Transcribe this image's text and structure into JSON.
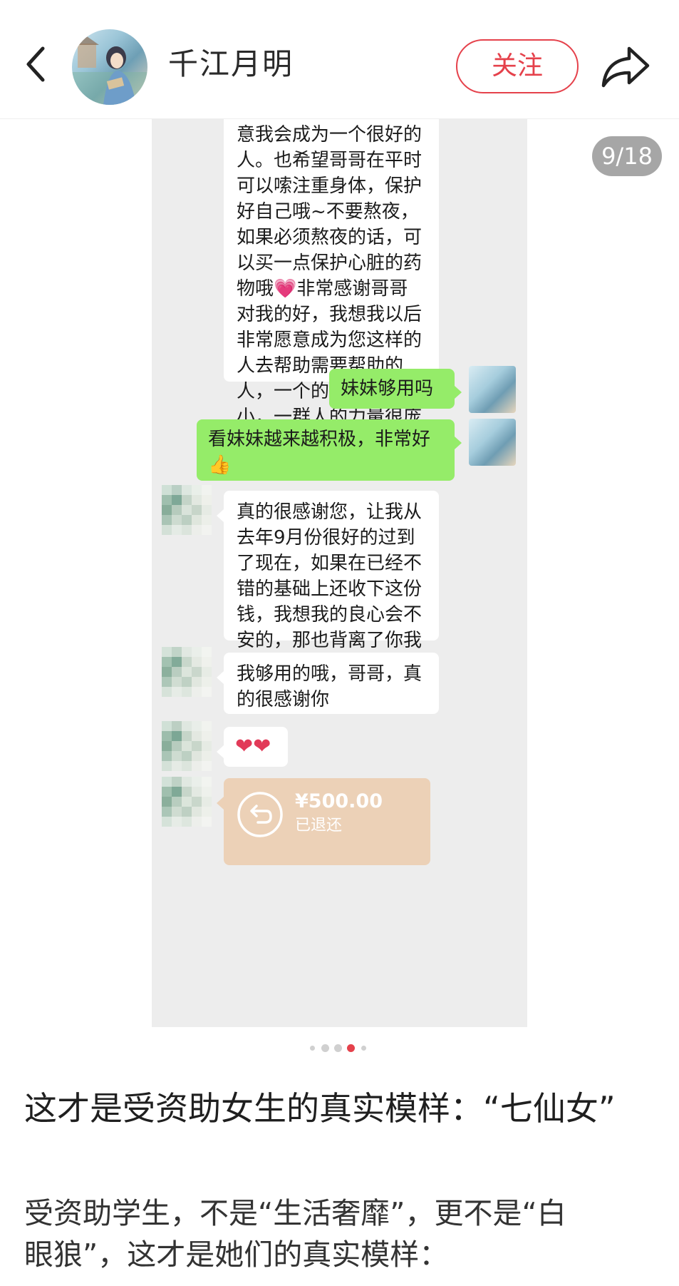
{
  "header": {
    "author_name": "千江月明",
    "follow_label": "关注",
    "back_icon": "chevron-left-icon",
    "share_icon": "share-arrow-icon"
  },
  "image": {
    "counter": "9/18",
    "current_page_indicator": 4,
    "total_indicator_dots": 5
  },
  "chat": {
    "messages": [
      {
        "side": "left",
        "text": "意我会成为一个很好的人。也希望哥哥在平时可以嗦注重身体，保护好自己哦~不要熬夜，如果必须熬夜的话，可以买一点保护心脏的药物哦💗非常感谢哥哥对我的好，我想我以后非常愿意成为您这样的人去帮助需要帮助的人，一个的力量很渺小，一群人的力量很庞大。再次感谢您🌹"
      },
      {
        "side": "right",
        "text": "妹妹够用吗"
      },
      {
        "side": "right",
        "text": "看妹妹越来越积极，非常好👍"
      },
      {
        "side": "left",
        "text": "真的很感谢您，让我从去年9月份很好的过到了现在，如果在已经不错的基础上还收下这份钱，我想我的良心会不安的，那也背离了你我的初衷"
      },
      {
        "side": "left",
        "text": "我够用的哦，哥哥，真的很感谢你"
      },
      {
        "side": "left",
        "text": "❤❤"
      }
    ],
    "transfer": {
      "amount": "¥500.00",
      "status": "已退还"
    }
  },
  "post": {
    "title": "这才是受资助女生的真实模样：“七仙女”",
    "body_line1": "受资助学生，不是“生活奢靡”，更不是“白",
    "body_line2": "眼狼”，这才是她们的真实模样："
  },
  "colors": {
    "accent": "#e5414b",
    "chat_bg": "#ededed",
    "green_bubble": "#95ec69",
    "transfer_card": "#ecd1b7"
  }
}
